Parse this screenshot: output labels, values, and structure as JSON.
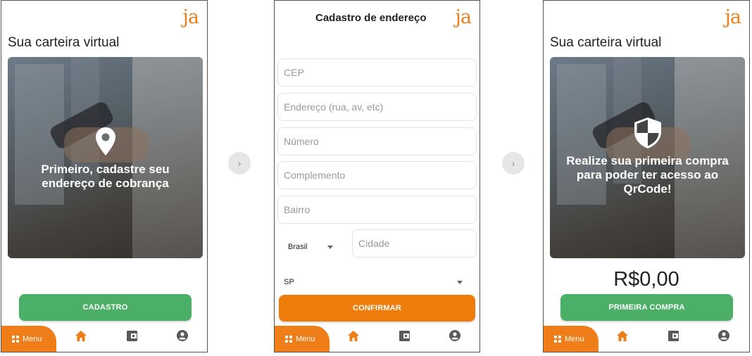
{
  "brand": {
    "logo": "ja",
    "accent": "#ef7d18",
    "green": "#4caf67"
  },
  "screen1": {
    "title": "Sua carteira virtual",
    "hero_icon": "location-pin-icon",
    "hero_text": "Primeiro, cadastre seu endereço de cobrança",
    "button": "CADASTRO"
  },
  "screen2": {
    "title": "Cadastro de endereço",
    "fields": {
      "cep": "CEP",
      "endereco": "Endereço (rua, av, etc)",
      "numero": "Número",
      "complemento": "Complemento",
      "bairro": "Bairro",
      "cidade": "Cidade"
    },
    "country_select": "Brasil",
    "state_select": "SP",
    "button": "CONFIRMAR"
  },
  "screen3": {
    "title": "Sua carteira virtual",
    "hero_icon": "shield-icon",
    "hero_text": "Realize sua primeira compra para poder ter acesso ao QrCode!",
    "balance": "R$0,00",
    "button": "PRIMEIRA COMPRA"
  },
  "nav": {
    "menu": "Menu",
    "icons": [
      "home-icon",
      "wallet-icon",
      "account-icon"
    ]
  },
  "arrows": {
    "symbol": "›"
  }
}
